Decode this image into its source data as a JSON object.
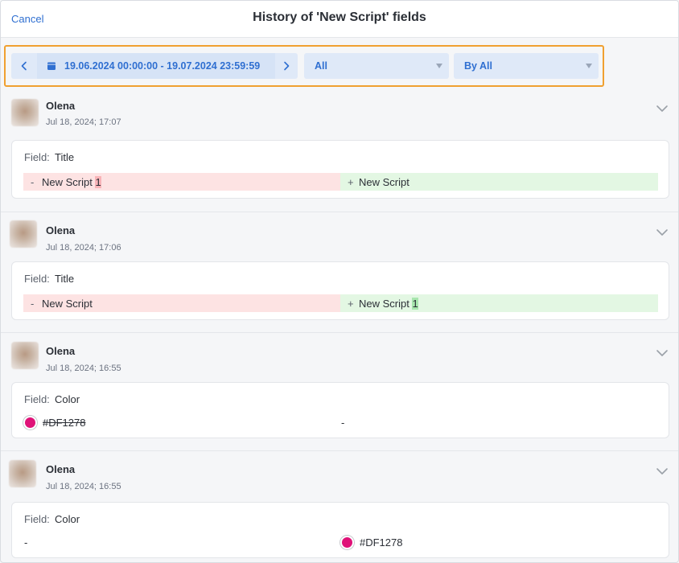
{
  "header": {
    "cancel_label": "Cancel",
    "title": "History of 'New Script' fields"
  },
  "filters": {
    "date_range": "19.06.2024 00:00:00 - 19.07.2024 23:59:59",
    "type_select": "All",
    "user_select": "By All"
  },
  "entries": [
    {
      "user": "Olena",
      "timestamp": "Jul 18, 2024; 17:07",
      "field_label": "Field:",
      "field_name": "Title",
      "old_sign": "-",
      "old_text": "New Script ",
      "old_highlight": "1",
      "new_sign": "+",
      "new_text": "New Script",
      "new_highlight": ""
    },
    {
      "user": "Olena",
      "timestamp": "Jul 18, 2024; 17:06",
      "field_label": "Field:",
      "field_name": "Title",
      "old_sign": "-",
      "old_text": "New Script",
      "old_highlight": "",
      "new_sign": "+",
      "new_text": "New Script ",
      "new_highlight": "1"
    },
    {
      "user": "Olena",
      "timestamp": "Jul 18, 2024; 16:55",
      "field_label": "Field:",
      "field_name": "Color",
      "old_color": "#DF1278",
      "old_value": "#DF1278",
      "new_value": "-"
    },
    {
      "user": "Olena",
      "timestamp": "Jul 18, 2024; 16:55",
      "field_label": "Field:",
      "field_name": "Color",
      "old_value": "-",
      "new_color": "#DF1278",
      "new_value": "#DF1278"
    }
  ],
  "colors": {
    "accent": "#2f6fd1",
    "filter_highlight": "#f0a030",
    "swatch": "#DF1278"
  },
  "icons": {
    "prev": "chevron-left-icon",
    "next": "chevron-right-icon",
    "calendar": "calendar-icon",
    "expand": "chevron-down-icon",
    "dropdown": "caret-down-icon"
  }
}
